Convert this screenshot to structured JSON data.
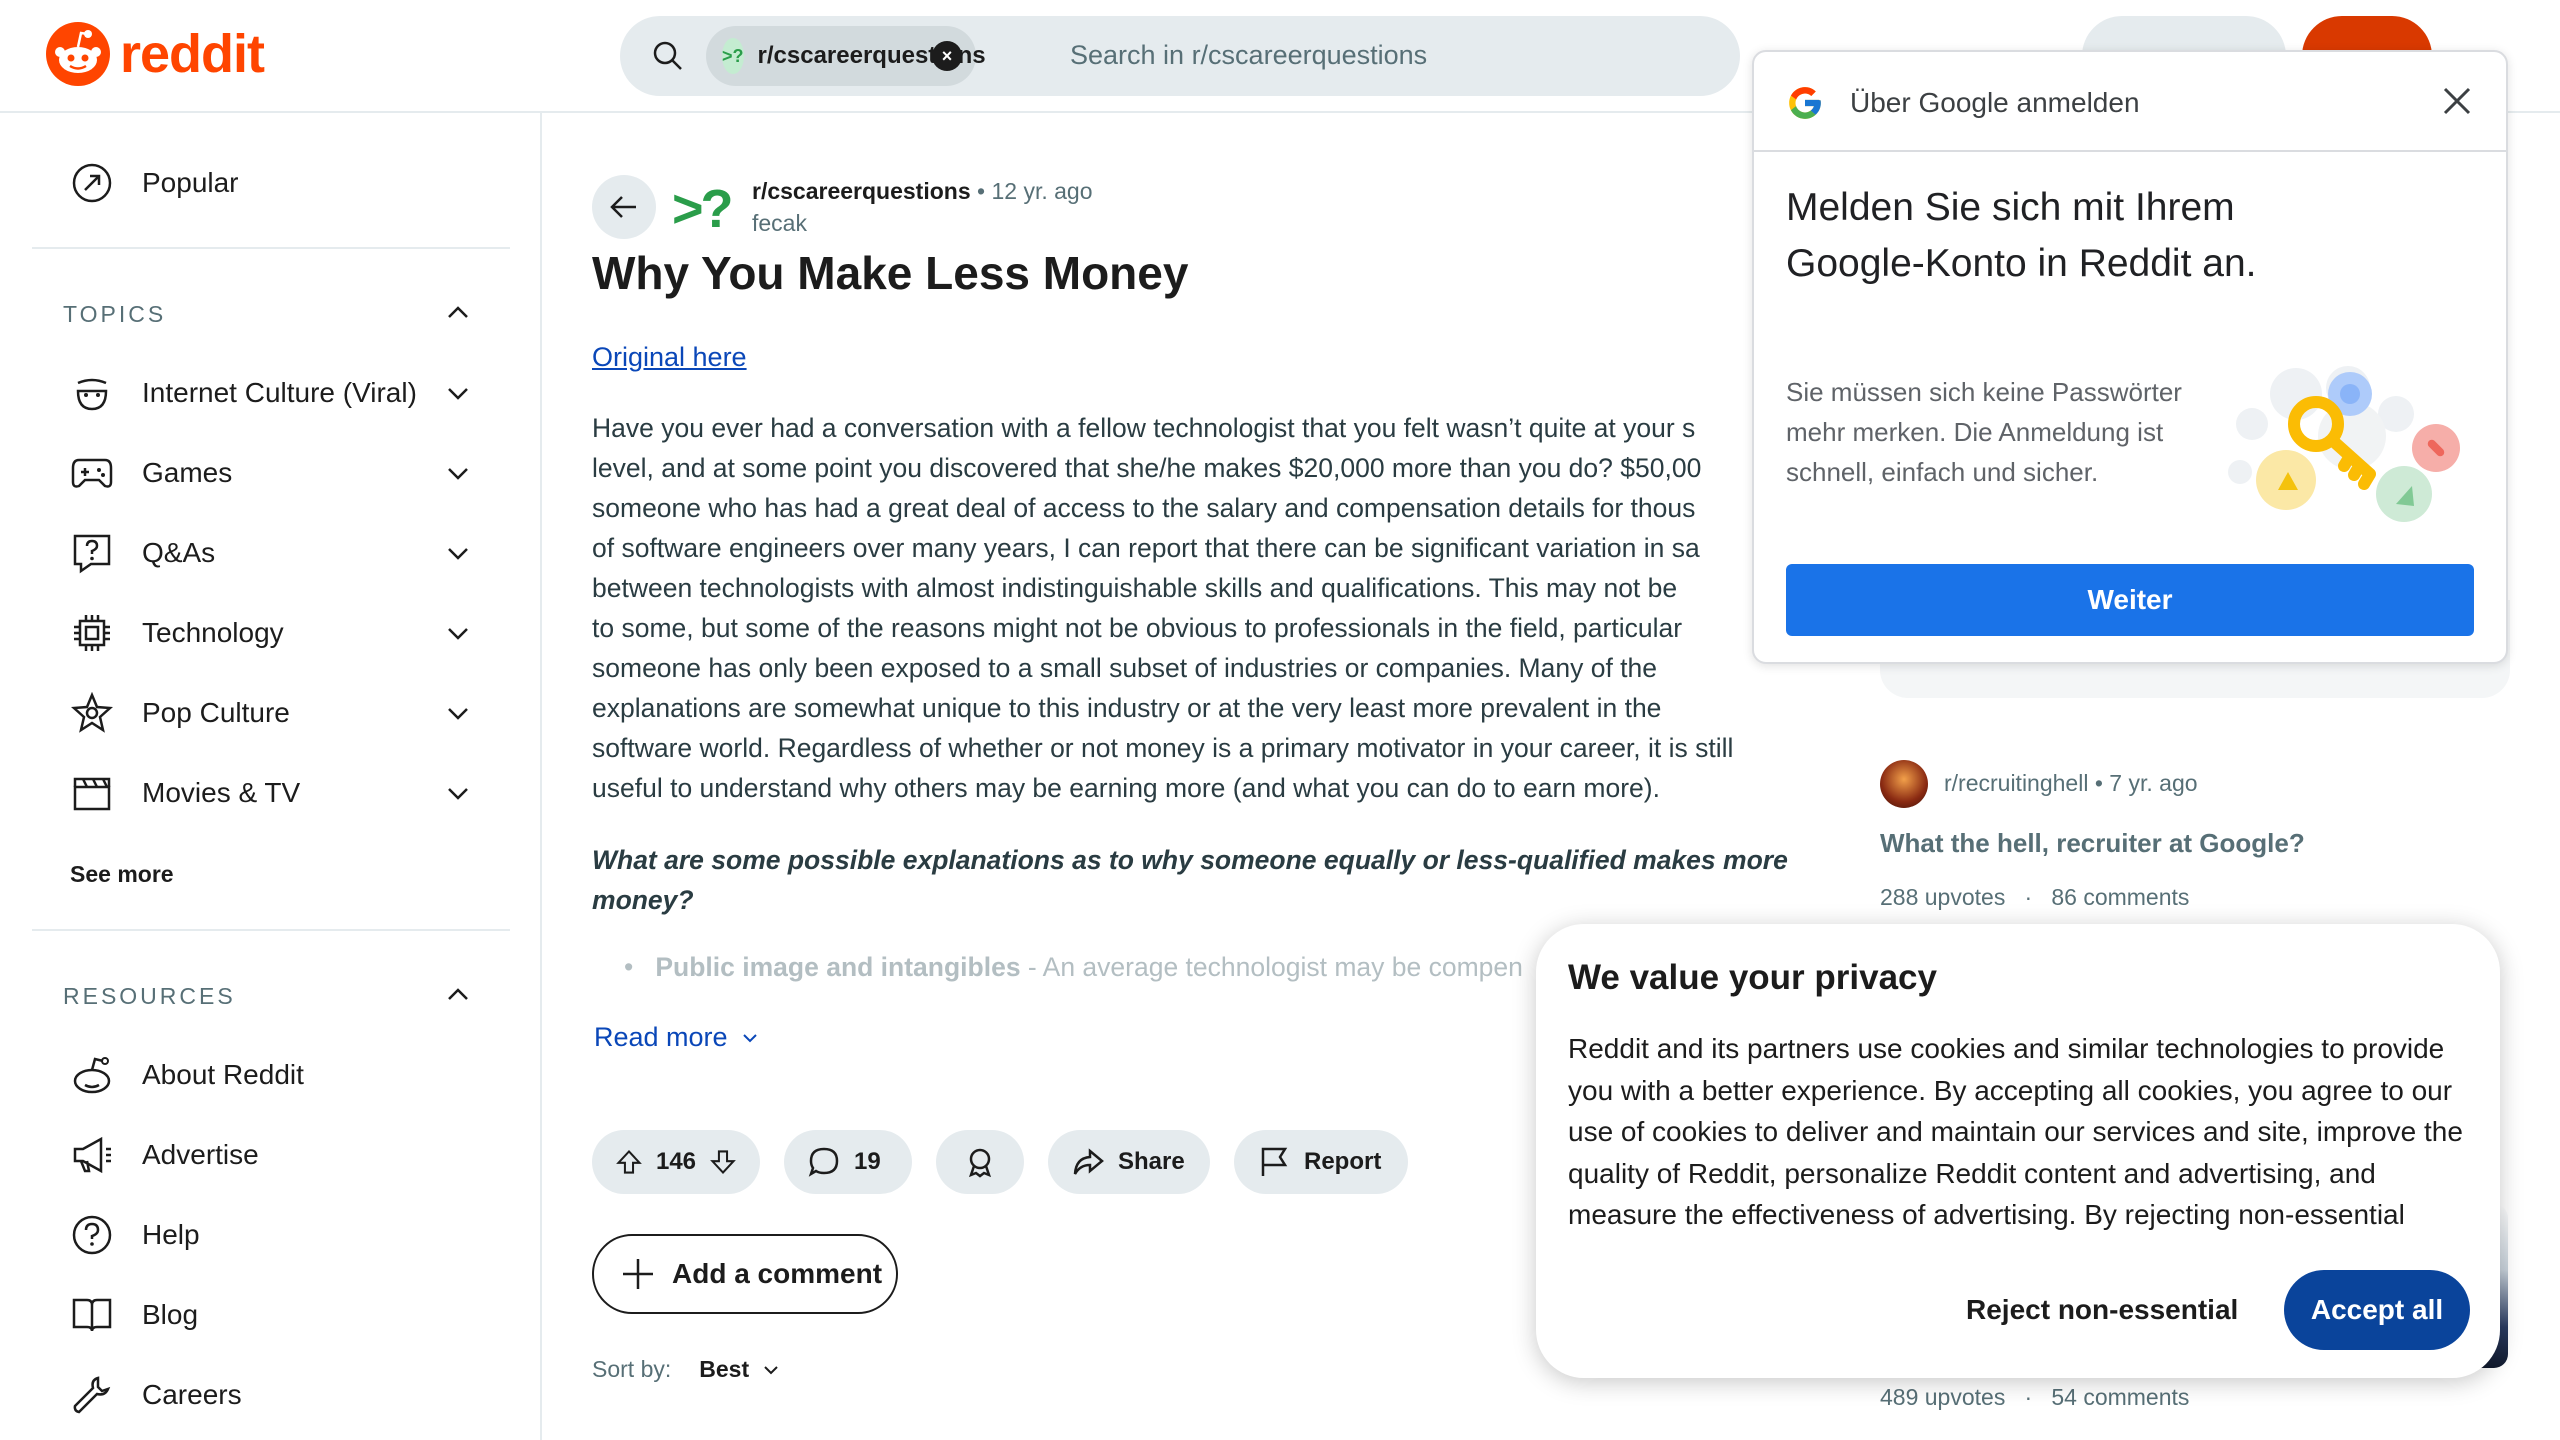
{
  "header": {
    "logo_text": "reddit",
    "search_chip": "r/cscareerquestions",
    "search_placeholder": "Search in r/cscareerquestions"
  },
  "sidebar": {
    "popular": "Popular",
    "topics_heading": "TOPICS",
    "topics": [
      {
        "label": "Internet Culture (Viral)",
        "icon": "smile-icon"
      },
      {
        "label": "Games",
        "icon": "gamepad-icon"
      },
      {
        "label": "Q&As",
        "icon": "question-bubble-icon"
      },
      {
        "label": "Technology",
        "icon": "chip-icon"
      },
      {
        "label": "Pop Culture",
        "icon": "star-badge-icon"
      },
      {
        "label": "Movies & TV",
        "icon": "clapperboard-icon"
      }
    ],
    "see_more": "See more",
    "resources_heading": "RESOURCES",
    "resources": [
      {
        "label": "About Reddit",
        "icon": "reddit-alien-icon"
      },
      {
        "label": "Advertise",
        "icon": "megaphone-icon"
      },
      {
        "label": "Help",
        "icon": "help-icon"
      },
      {
        "label": "Blog",
        "icon": "book-icon"
      },
      {
        "label": "Careers",
        "icon": "wrench-icon"
      }
    ]
  },
  "post": {
    "subreddit": "r/cscareerquestions",
    "age": "12 yr. ago",
    "author": "fecak",
    "title": "Why You Make Less Money",
    "link_text": "Original here",
    "body": [
      "Have you ever had a conversation with a fellow technologist that you felt wasn’t quite at your s",
      "level, and at some point you discovered that she/he makes $20,000 more than you do? $50,00",
      "someone who has had a great deal of access to the salary and compensation details for thous",
      "of software engineers over many years, I can report that there can be significant variation in sa",
      "between technologists with almost indistinguishable skills and qualifications. This may not be",
      "to some, but some of the reasons might not be obvious to professionals in the field, particular",
      "someone has only been exposed to a small subset of industries or companies. Many of the",
      "explanations are somewhat unique to this industry or at the very least more prevalent in the",
      "software world. Regardless of whether or not money is a primary motivator in your career, it is still",
      "useful to understand why others may be earning more (and what you can do to earn more)."
    ],
    "italic_question": "What are some possible explanations as to why someone equally or less-qualified makes more money?",
    "bullet_bold": "Public image and intangibles",
    "bullet_rest": " - An average technologist may be compen",
    "read_more": "Read more",
    "votes": "146",
    "comments": "19",
    "share": "Share",
    "report": "Report",
    "add_comment": "Add a comment",
    "sort_label": "Sort by:",
    "sort_value": "Best"
  },
  "rail": {
    "post1": {
      "subreddit": "r/recruitinghell",
      "age": "7 yr. ago",
      "title": "What the hell, recruiter at Google?",
      "upvotes": "288 upvotes",
      "comments": "86 comments"
    },
    "post2": {
      "upvotes": "489 upvotes",
      "comments": "54 comments"
    }
  },
  "google": {
    "head": "Über Google anmelden",
    "title": "Melden Sie sich mit Ihrem Google-Konto in Reddit an.",
    "desc": "Sie müssen sich keine Passwörter mehr merken. Die Anmeldung ist schnell, einfach und sicher.",
    "button": "Weiter"
  },
  "cookie": {
    "title": "We value your privacy",
    "body": "Reddit and its partners use cookies and similar technologies to provide you with a better experience. By accepting all cookies, you agree to our use of cookies to deliver and maintain our services and site, improve the quality of Reddit, personalize Reddit content and advertising, and measure the effectiveness of advertising. By rejecting non-essential",
    "reject": "Reject non-essential",
    "accept": "Accept all"
  },
  "colors": {
    "brand": "#ff4500",
    "link": "#0a47b8",
    "accept_button": "#0a449b",
    "google_button": "#1a73e8",
    "subreddit_icon": "#2a9d4a"
  }
}
